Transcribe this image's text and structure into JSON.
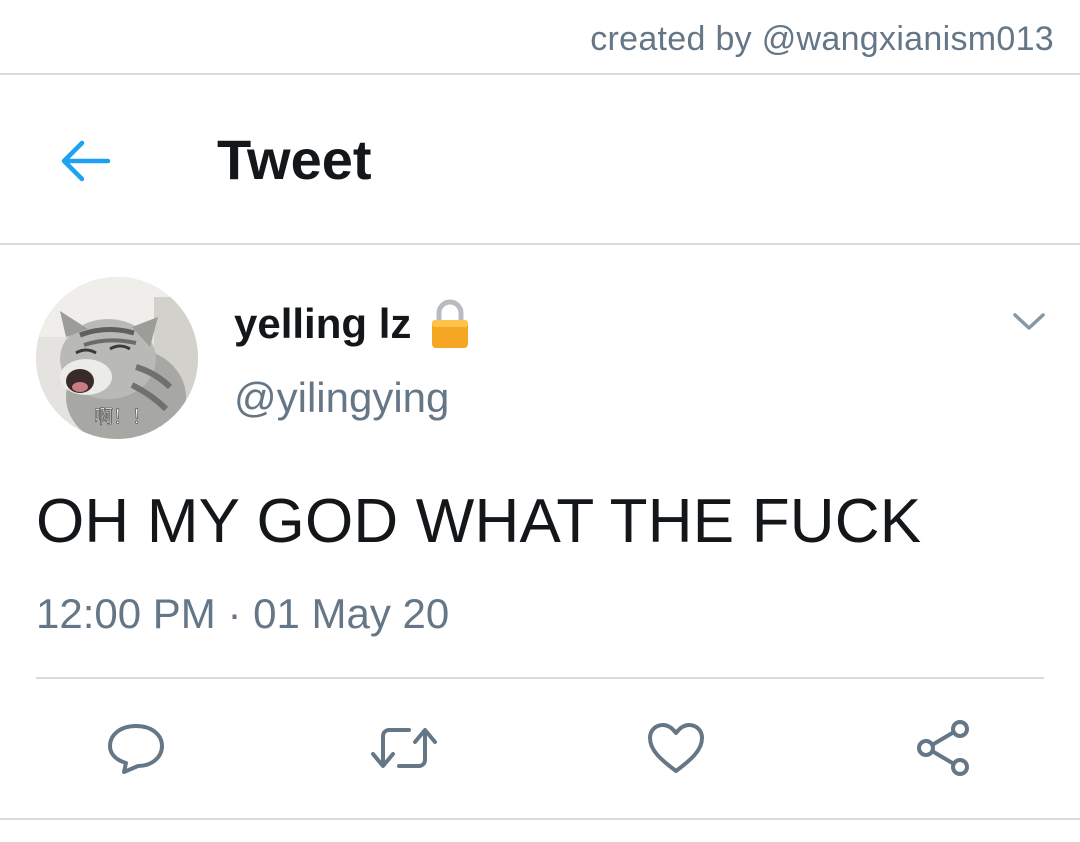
{
  "watermark": "created by @wangxianism013",
  "header": {
    "title": "Tweet",
    "back_icon": "arrow-left-icon"
  },
  "tweet": {
    "display_name": "yelling lz",
    "handle": "@yilingying",
    "text": "OH MY GOD WHAT THE FUCK",
    "timestamp": "12:00 PM · 01 May 20",
    "avatar_caption": "啊！！"
  },
  "actions": [
    {
      "name": "reply",
      "icon": "reply-icon"
    },
    {
      "name": "retweet",
      "icon": "retweet-icon"
    },
    {
      "name": "like",
      "icon": "heart-icon"
    },
    {
      "name": "share",
      "icon": "share-icon"
    }
  ],
  "colors": {
    "accent": "#1da1f2",
    "text_primary": "#14171a",
    "text_secondary": "#657786",
    "divider": "#d5dbe0",
    "lock": "#f5a623"
  }
}
